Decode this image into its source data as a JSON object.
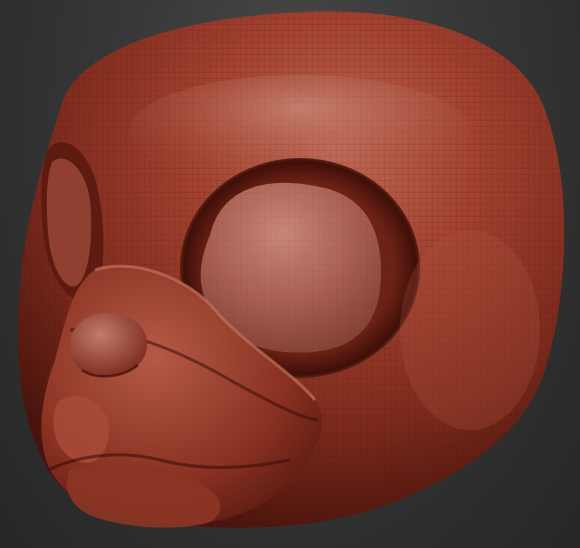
{
  "viewport": {
    "background_color": "#333333"
  },
  "model": {
    "subject": "sculpted-animal-head",
    "material_color": "#9a3c2c",
    "highlight_color": "#c97a66",
    "shadow_color": "#4a140c",
    "wireframe_visible": true
  }
}
